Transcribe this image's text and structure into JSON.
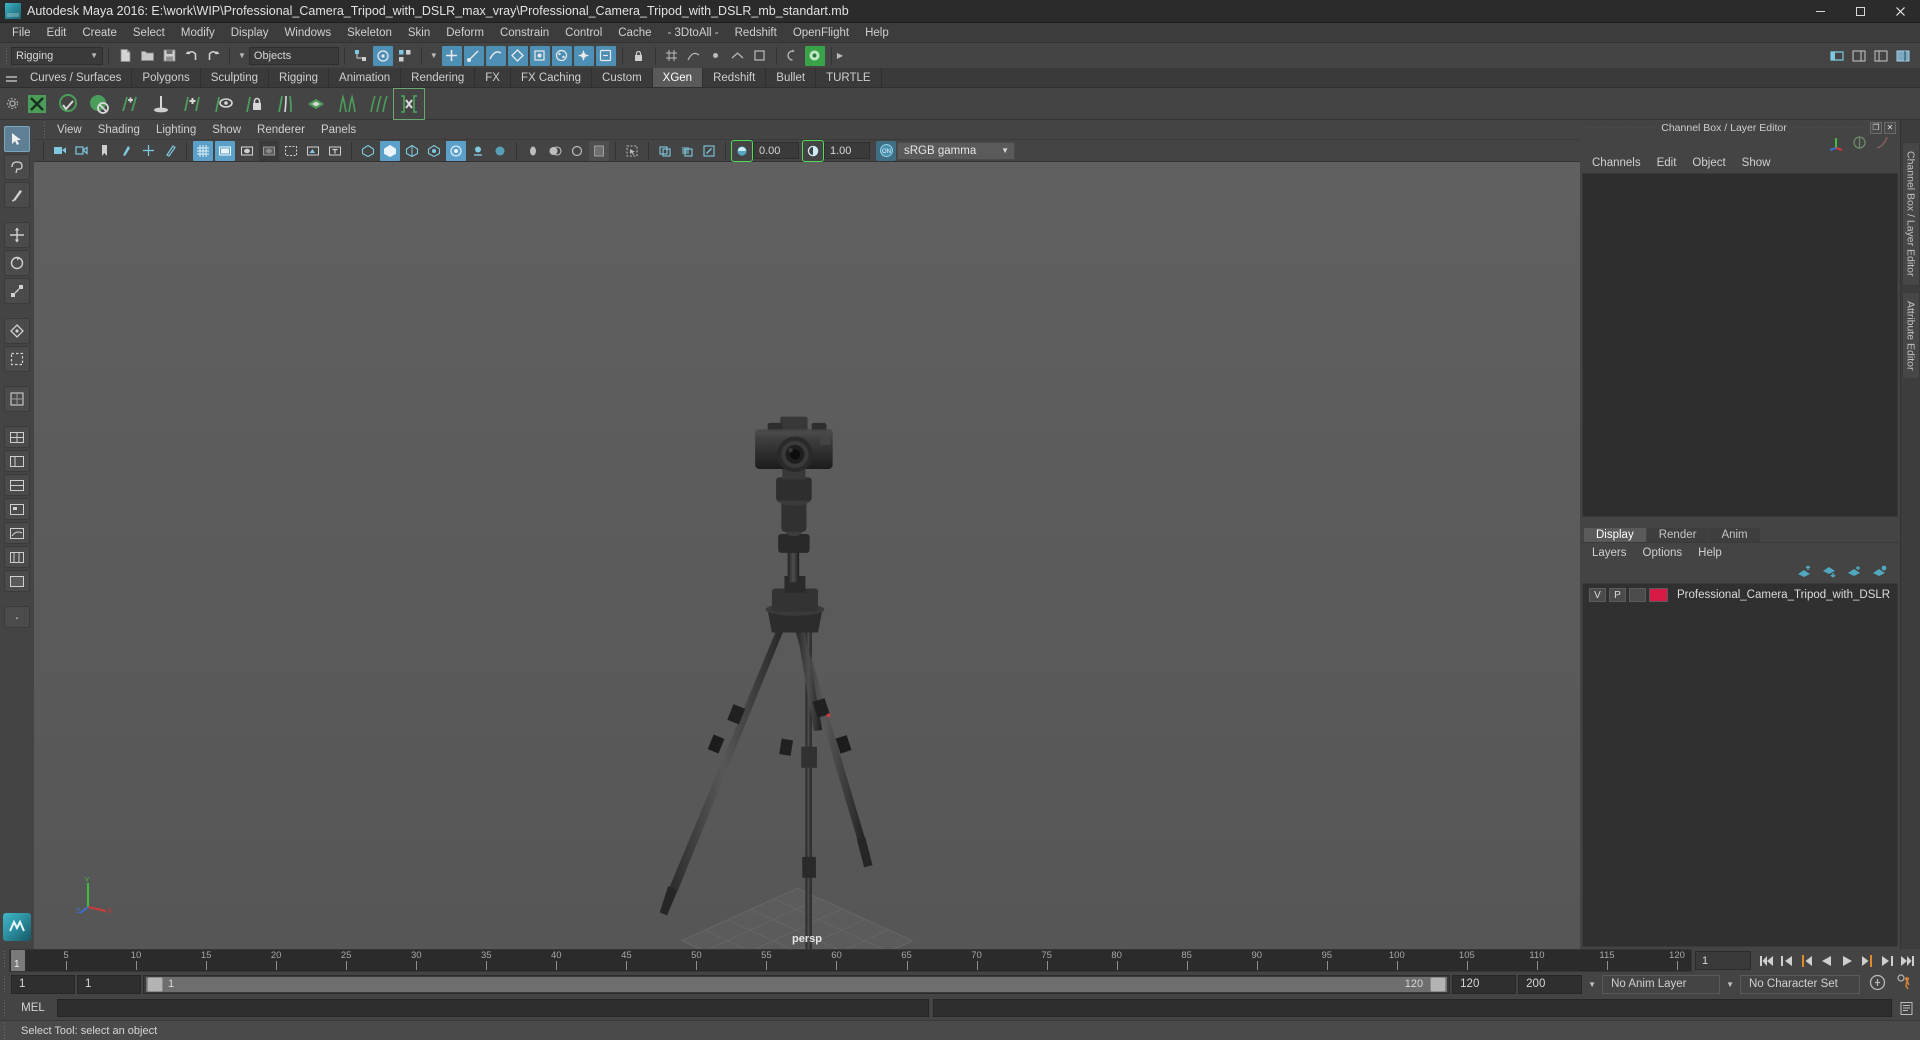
{
  "window": {
    "title": "Autodesk Maya 2016: E:\\work\\WIP\\Professional_Camera_Tripod_with_DSLR_max_vray\\Professional_Camera_Tripod_with_DSLR_mb_standart.mb",
    "minimize_label": "—",
    "maximize_label": "❐",
    "close_label": "✕"
  },
  "menubar": [
    "File",
    "Edit",
    "Create",
    "Select",
    "Modify",
    "Display",
    "Windows",
    "Skeleton",
    "Skin",
    "Deform",
    "Constrain",
    "Control",
    "Cache",
    "- 3DtoAll -",
    "Redshift",
    "OpenFlight",
    "Help"
  ],
  "statusline": {
    "menuset": "Rigging",
    "selection_mask": "Objects"
  },
  "shelf": {
    "tabs": [
      "Curves / Surfaces",
      "Polygons",
      "Sculpting",
      "Rigging",
      "Animation",
      "Rendering",
      "FX",
      "FX Caching",
      "Custom",
      "XGen",
      "Redshift",
      "Bullet",
      "TURTLE"
    ],
    "active_tab": "XGen"
  },
  "viewport_panel": {
    "menus": [
      "View",
      "Shading",
      "Lighting",
      "Show",
      "Renderer",
      "Panels"
    ],
    "exposure_value": "0.00",
    "gamma_value": "1.00",
    "color_management": "sRGB gamma",
    "camera_label": "persp"
  },
  "channel_box": {
    "title": "Channel Box / Layer Editor",
    "menus": [
      "Channels",
      "Edit",
      "Object",
      "Show"
    ]
  },
  "layer_editor": {
    "tabs": [
      "Display",
      "Render",
      "Anim"
    ],
    "active_tab": "Display",
    "menus": [
      "Layers",
      "Options",
      "Help"
    ],
    "layers": [
      {
        "visibility": "V",
        "playback": "P",
        "shading": "",
        "color": "#d81b45",
        "name": "Professional_Camera_Tripod_with_DSLR"
      }
    ]
  },
  "vertical_tabs": [
    "Channel Box / Layer Editor",
    "Attribute Editor"
  ],
  "timeline": {
    "tick_labels": [
      "5",
      "10",
      "15",
      "20",
      "25",
      "30",
      "35",
      "40",
      "45",
      "50",
      "55",
      "60",
      "65",
      "70",
      "75",
      "80",
      "85",
      "90",
      "95",
      "100",
      "105",
      "110",
      "115",
      "120"
    ],
    "tick_start": 5,
    "tick_step": 5,
    "range_start": 1,
    "range_end": 120,
    "current_frame": "1",
    "current_frame_field": "1",
    "playback_buttons": [
      "go-to-start",
      "step-back-key",
      "step-back-frame",
      "play-backwards",
      "play-forwards",
      "step-forward-frame",
      "step-forward-key",
      "go-to-end"
    ]
  },
  "range_slider": {
    "anim_start": "1",
    "playback_start": "1",
    "slider_start_value": "1",
    "slider_end_value": "120",
    "playback_end": "120",
    "anim_end": "200",
    "anim_layer": "No Anim Layer",
    "character_set": "No Character Set"
  },
  "command_line": {
    "label": "MEL",
    "input_value": "",
    "input_placeholder": ""
  },
  "status_bar": {
    "message": "Select Tool: select an object"
  },
  "colors": {
    "accent_blue": "#4d8fb5",
    "shelf_green": "#4a9e5a",
    "layer_red": "#d81b45",
    "panel_bg": "#444444",
    "viewport_bg": "#5d5d5d"
  }
}
